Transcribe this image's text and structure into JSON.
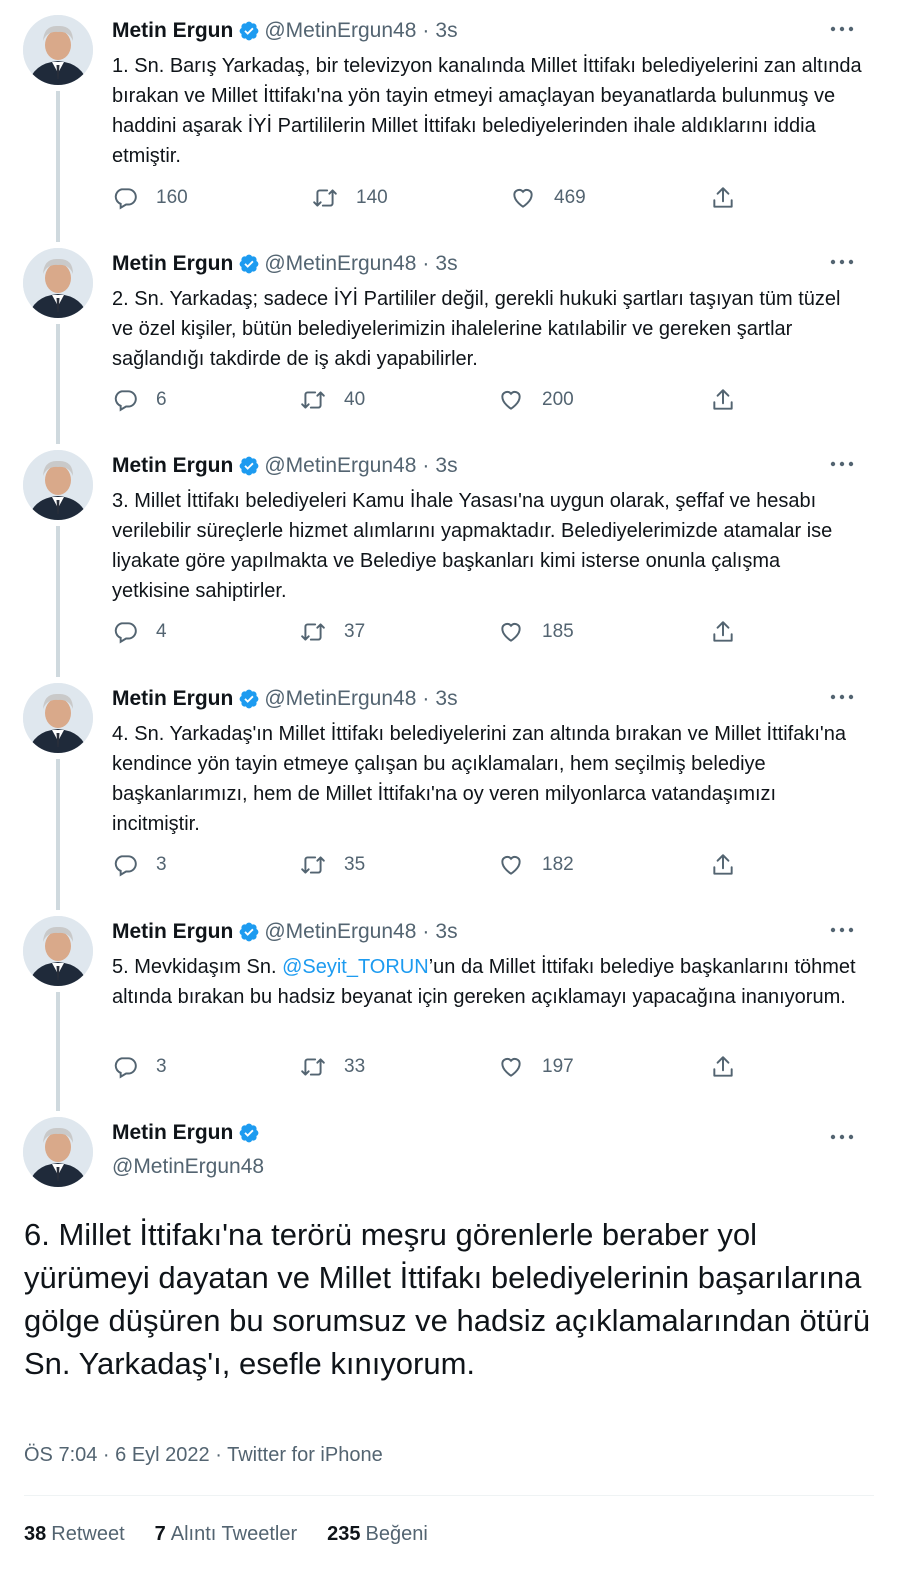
{
  "colors": {
    "link": "#1d9bf0",
    "muted": "#536471",
    "text": "#0f1419"
  },
  "thread": [
    {
      "name": "Metin Ergun",
      "handle": "@MetinErgun48",
      "time": "3s",
      "text_parts": [
        {
          "t": "1. Sn. Barış Yarkadaş, bir televizyon kanalında Millet İttifakı belediyelerini zan altında bırakan ve Millet İttifakı'na yön tayin etmeyi amaçlayan beyanatlarda bulunmuş ve haddini aşarak İYİ Partililerin Millet İttifakı belediyelerinden ihale aldıklarını iddia etmiştir."
        }
      ],
      "replies": "160",
      "retweets": "140",
      "likes": "469"
    },
    {
      "name": "Metin Ergun",
      "handle": "@MetinErgun48",
      "time": "3s",
      "text_parts": [
        {
          "t": "2. Sn. Yarkadaş; sadece İYİ Partililer değil, gerekli hukuki şartları taşıyan tüm tüzel ve özel kişiler, bütün belediyelerimizin ihalelerine katılabilir ve gereken şartlar sağlandığı takdirde de iş akdi yapabilirler."
        }
      ],
      "replies": "6",
      "retweets": "40",
      "likes": "200"
    },
    {
      "name": "Metin Ergun",
      "handle": "@MetinErgun48",
      "time": "3s",
      "text_parts": [
        {
          "t": "3. Millet İttifakı belediyeleri Kamu İhale Yasası'na uygun olarak, şeffaf ve hesabı verilebilir süreçlerle hizmet alımlarını yapmaktadır. Belediyelerimizde atamalar ise liyakate göre yapılmakta ve Belediye başkanları kimi isterse onunla çalışma yetkisine sahiptirler."
        }
      ],
      "replies": "4",
      "retweets": "37",
      "likes": "185"
    },
    {
      "name": "Metin Ergun",
      "handle": "@MetinErgun48",
      "time": "3s",
      "text_parts": [
        {
          "t": "4. Sn. Yarkadaş'ın Millet İttifakı belediyelerini zan altında bırakan ve Millet İttifakı'na kendince yön tayin etmeye çalışan bu açıklamaları, hem seçilmiş belediye başkanlarımızı, hem de Millet İttifakı'na oy veren milyonlarca vatandaşımızı incitmiştir."
        }
      ],
      "replies": "3",
      "retweets": "35",
      "likes": "182"
    },
    {
      "name": "Metin Ergun",
      "handle": "@MetinErgun48",
      "time": "3s",
      "text_parts": [
        {
          "t": "5. Mevkidaşım Sn. "
        },
        {
          "t": "@Seyit_TORUN",
          "mention": true
        },
        {
          "t": "’un da Millet İttifakı belediye başkanlarını töhmet altında bırakan bu hadsiz beyanat için gereken açıklamayı yapacağına inanıyorum."
        }
      ],
      "replies": "3",
      "retweets": "33",
      "likes": "197"
    }
  ],
  "main_tweet": {
    "name": "Metin Ergun",
    "handle": "@MetinErgun48",
    "text": "6. Millet İttifakı'na terörü meşru görenlerle beraber yol yürümeyi dayatan ve Millet İttifakı belediyelerinin başarılarına gölge düşüren bu sorumsuz ve hadsiz açıklamalarından ötürü Sn. Yarkadaş'ı, esefle kınıyorum.",
    "meta": "ÖS 7:04 · 6 Eyl 2022 · Twitter for iPhone",
    "retweet_count": "38",
    "retweet_label": "Retweet",
    "quote_count": "7",
    "quote_label": "Alıntı Tweetler",
    "like_count": "235",
    "like_label": "Beğeni"
  }
}
